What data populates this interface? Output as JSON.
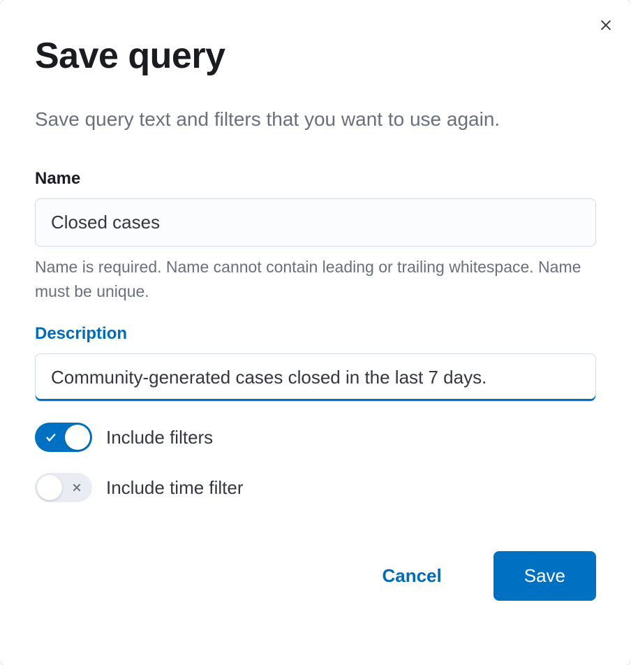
{
  "modal": {
    "title": "Save query",
    "subtitle": "Save query text and filters that you want to use again.",
    "name_field": {
      "label": "Name",
      "value": "Closed cases",
      "help_text": "Name is required. Name cannot contain leading or trailing whitespace. Name must be unique."
    },
    "description_field": {
      "label": "Description",
      "value": "Community-generated cases closed in the last 7 days."
    },
    "toggles": {
      "include_filters": {
        "label": "Include filters",
        "checked": true
      },
      "include_time_filter": {
        "label": "Include time filter",
        "checked": false
      }
    },
    "buttons": {
      "cancel": "Cancel",
      "save": "Save"
    }
  }
}
